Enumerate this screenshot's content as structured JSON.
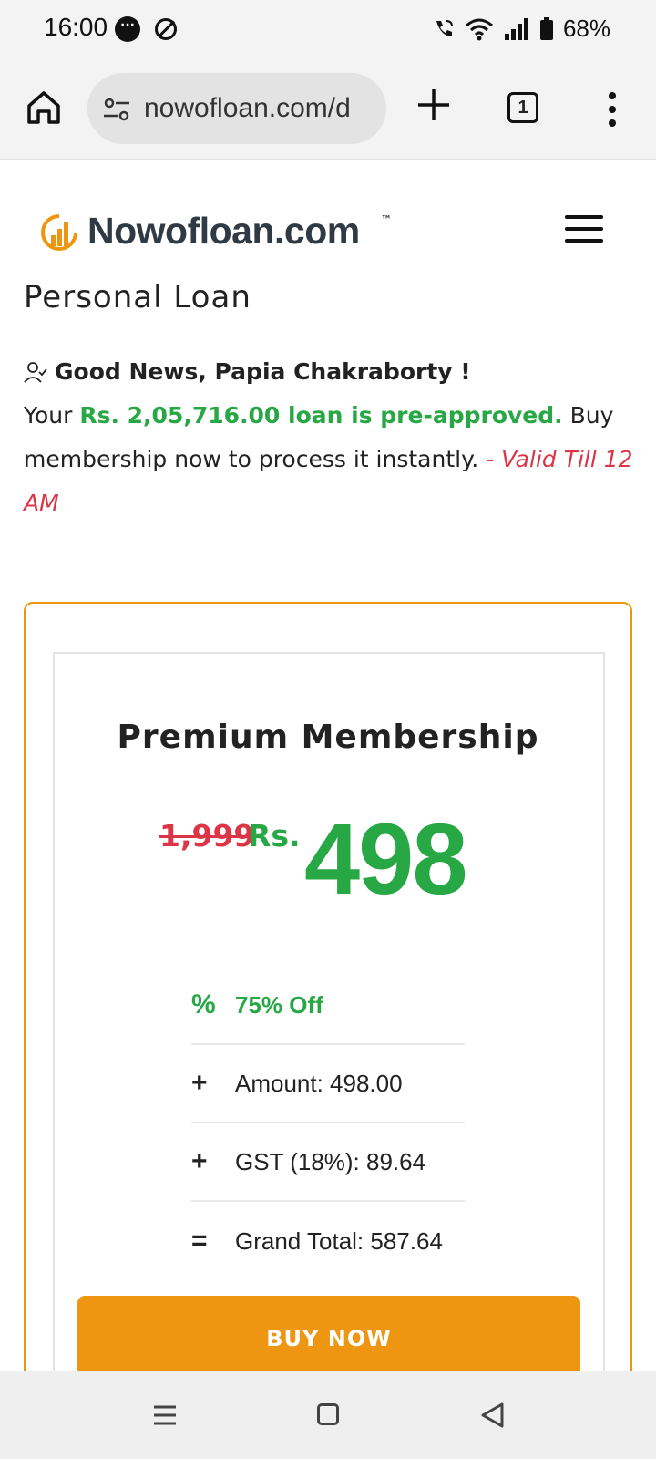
{
  "status_bar": {
    "time": "16:00",
    "battery_pct": "68%"
  },
  "browser": {
    "url": "nowofloan.com/d",
    "tab_count": "1"
  },
  "site": {
    "logo_text": "Nowofloan.com",
    "logo_tm": "™"
  },
  "page": {
    "title": "Personal Loan",
    "greeting": "Good News, Papia Chakraborty !",
    "line_prefix": "Your ",
    "approved_text": "Rs. 2,05,716.00 loan is pre-approved.",
    "line_suffix": " Buy membership now to process it instantly. ",
    "validity": "- Valid Till 12 AM"
  },
  "membership": {
    "title": "Premium Membership",
    "old_price": "1,999",
    "currency": "Rs.",
    "price": "498",
    "features": [
      {
        "icon": "%",
        "text": "75% Off"
      },
      {
        "icon": "+",
        "text": "Amount: 498.00"
      },
      {
        "icon": "+",
        "text": "GST (18%): 89.64"
      },
      {
        "icon": "=",
        "text": "Grand Total: 587.64"
      }
    ],
    "buy_label": "BUY NOW"
  },
  "colors": {
    "accent_orange": "#ee9612",
    "green": "#28a745",
    "red": "#dc3545"
  }
}
